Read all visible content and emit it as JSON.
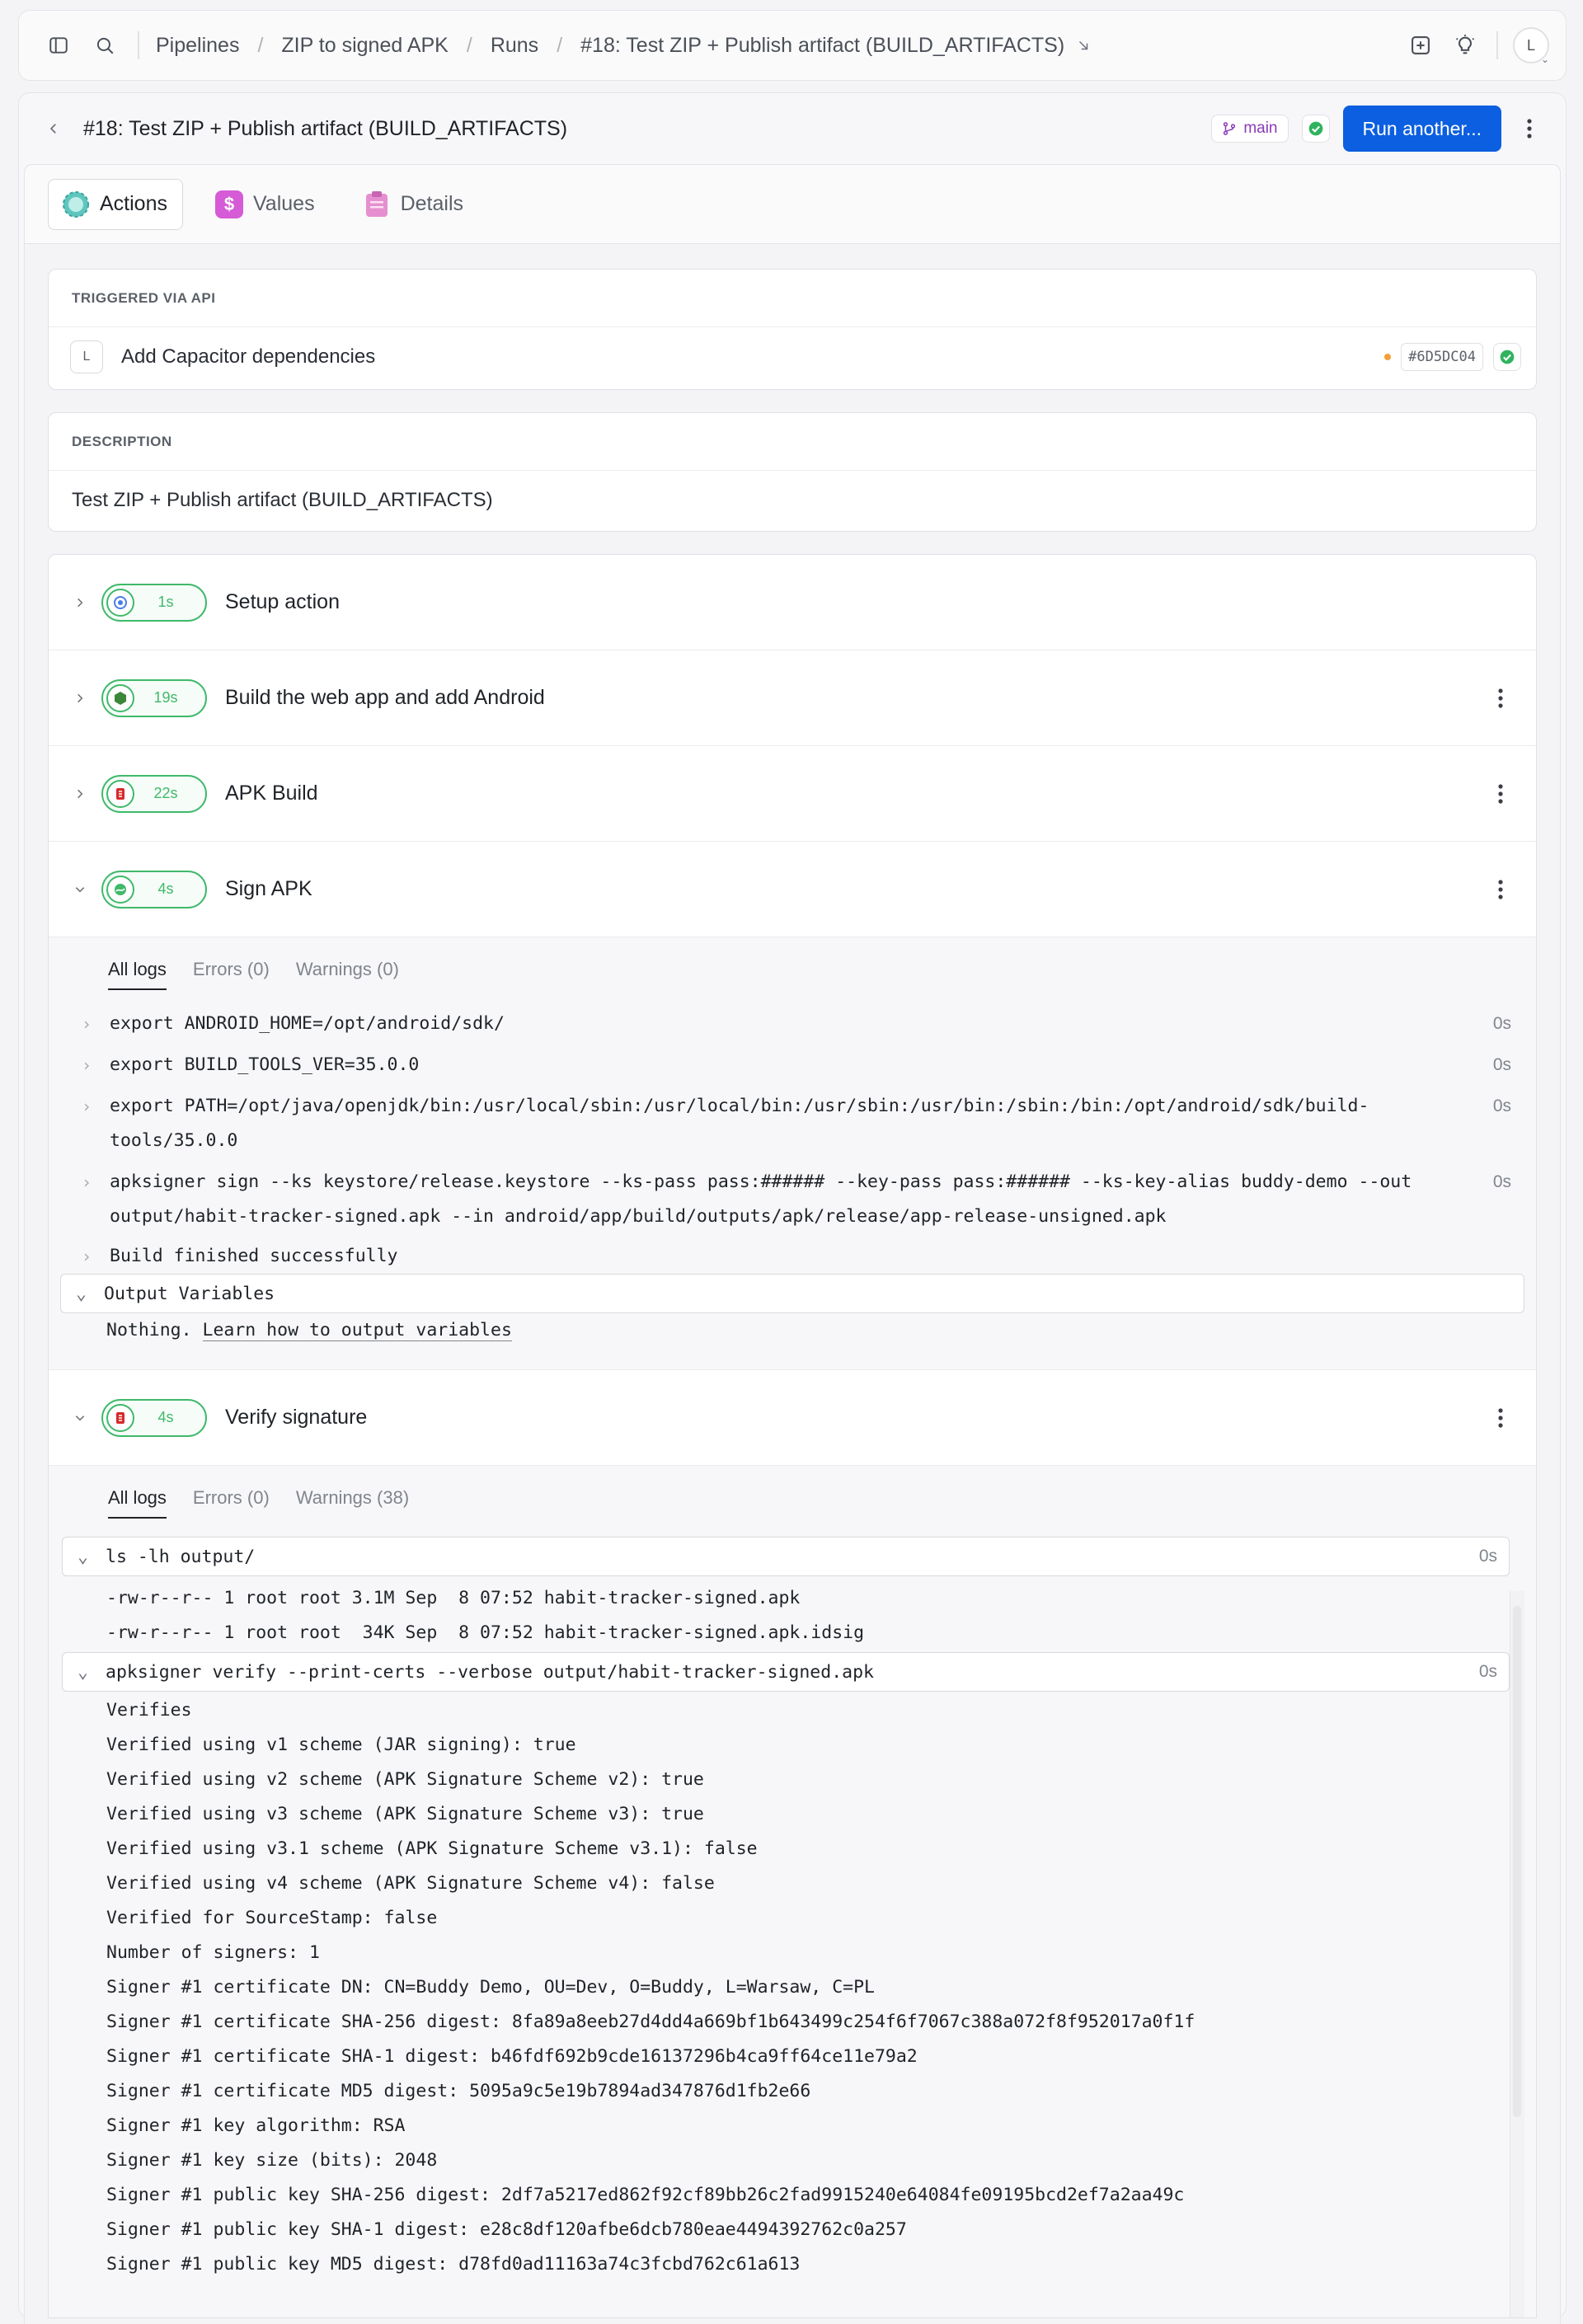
{
  "breadcrumbs": [
    "Pipelines",
    "ZIP to signed APK",
    "Runs",
    "#18: Test ZIP + Publish artifact (BUILD_ARTIFACTS)"
  ],
  "avatar_initial": "L",
  "run": {
    "title": "#18: Test ZIP + Publish artifact (BUILD_ARTIFACTS)",
    "branch": "main",
    "run_button": "Run another..."
  },
  "tabs": [
    {
      "label": "Actions",
      "icon": "actions-icon",
      "color": "#5fc6bf"
    },
    {
      "label": "Values",
      "icon": "dollar-icon",
      "color": "#d65bd6"
    },
    {
      "label": "Details",
      "icon": "clipboard-icon",
      "color": "#e58fd0"
    }
  ],
  "trigger": {
    "label": "TRIGGERED VIA API",
    "avatar": "L",
    "commit_message": "Add Capacitor dependencies",
    "commit_hash": "#6D5DC04"
  },
  "description": {
    "label": "DESCRIPTION",
    "text": "Test ZIP + Publish artifact (BUILD_ARTIFACTS)"
  },
  "actions": [
    {
      "name": "Setup action",
      "time": "1s",
      "icon": "setup-icon",
      "expanded": false
    },
    {
      "name": "Build the web app and add Android",
      "time": "19s",
      "icon": "node-icon",
      "expanded": false
    },
    {
      "name": "APK Build",
      "time": "22s",
      "icon": "build-icon",
      "expanded": false
    },
    {
      "name": "Sign APK",
      "time": "4s",
      "icon": "sign-icon",
      "expanded": true
    },
    {
      "name": "Verify signature",
      "time": "4s",
      "icon": "verify-icon",
      "expanded": true
    }
  ],
  "sign_logs": {
    "tabs": [
      "All logs",
      "Errors (0)",
      "Warnings (0)"
    ],
    "lines": [
      {
        "text": "export ANDROID_HOME=/opt/android/sdk/",
        "time": "0s"
      },
      {
        "text": "export BUILD_TOOLS_VER=35.0.0",
        "time": "0s"
      },
      {
        "text": "export PATH=/opt/java/openjdk/bin:/usr/local/sbin:/usr/local/bin:/usr/sbin:/usr/bin:/sbin:/bin:/opt/android/sdk/build-\ntools/35.0.0",
        "time": "0s"
      },
      {
        "text": "apksigner sign --ks keystore/release.keystore --ks-pass pass:###### --key-pass pass:###### --ks-key-alias buddy-demo --out\noutput/habit-tracker-signed.apk --in android/app/build/outputs/apk/release/app-release-unsigned.apk",
        "time": "0s"
      },
      {
        "text": "Build finished successfully",
        "time": ""
      }
    ],
    "output_variables_label": "Output Variables",
    "output_nothing": "Nothing.",
    "output_link": "Learn how to output variables"
  },
  "verify_logs": {
    "tabs": [
      "All logs",
      "Errors (0)",
      "Warnings (38)"
    ],
    "group1": {
      "command": "ls -lh output/",
      "time": "0s"
    },
    "group1_lines": [
      "-rw-r--r-- 1 root root 3.1M Sep  8 07:52 habit-tracker-signed.apk",
      "-rw-r--r-- 1 root root  34K Sep  8 07:52 habit-tracker-signed.apk.idsig"
    ],
    "group2": {
      "command": "apksigner verify --print-certs --verbose output/habit-tracker-signed.apk",
      "time": "0s"
    },
    "group2_lines": [
      "Verifies",
      "Verified using v1 scheme (JAR signing): true",
      "Verified using v2 scheme (APK Signature Scheme v2): true",
      "Verified using v3 scheme (APK Signature Scheme v3): true",
      "Verified using v3.1 scheme (APK Signature Scheme v3.1): false",
      "Verified using v4 scheme (APK Signature Scheme v4): false",
      "Verified for SourceStamp: false",
      "Number of signers: 1",
      "Signer #1 certificate DN: CN=Buddy Demo, OU=Dev, O=Buddy, L=Warsaw, C=PL",
      "Signer #1 certificate SHA-256 digest: 8fa89a8eeb27d4dd4a669bf1b643499c254f6f7067c388a072f8f952017a0f1f",
      "Signer #1 certificate SHA-1 digest: b46fdf692b9cde16137296b4ca9ff64ce11e79a2",
      "Signer #1 certificate MD5 digest: 5095a9c5e19b7894ad347876d1fb2e66",
      "Signer #1 key algorithm: RSA",
      "Signer #1 key size (bits): 2048",
      "Signer #1 public key SHA-256 digest: 2df7a5217ed862f92cf89bb26c2fad9915240e64084fe09195bcd2ef7a2aa49c",
      "Signer #1 public key SHA-1 digest: e28c8df120afbe6dcb780eae4494392762c0a257",
      "Signer #1 public key MD5 digest: d78fd0ad11163a74c3fcbd762c61a613"
    ]
  }
}
